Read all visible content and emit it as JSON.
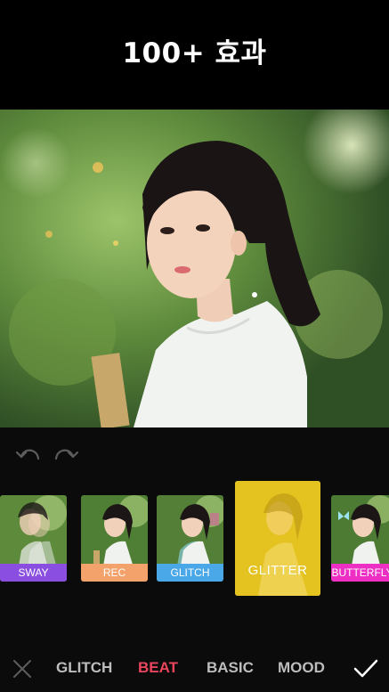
{
  "header": {
    "title": "100+ 효과"
  },
  "toolbar": {
    "undo_icon": "undo-icon",
    "redo_icon": "redo-icon"
  },
  "effects": [
    {
      "label": "SWAY",
      "color": "#8a4ee0"
    },
    {
      "label": "REC",
      "color": "#f2a26a"
    },
    {
      "label": "GLITCH",
      "color": "#4aa8e8"
    },
    {
      "label": "GLITTER",
      "color": "#e4c21f",
      "selected": true
    },
    {
      "label": "BUTTERFLY",
      "color": "#ee2fc4"
    }
  ],
  "tabs": {
    "items": [
      "GLITCH",
      "BEAT",
      "BASIC",
      "MOOD"
    ],
    "active": "BEAT",
    "active_color": "#e9455c"
  },
  "actions": {
    "cancel_icon": "close-icon",
    "confirm_icon": "checkmark-icon"
  }
}
